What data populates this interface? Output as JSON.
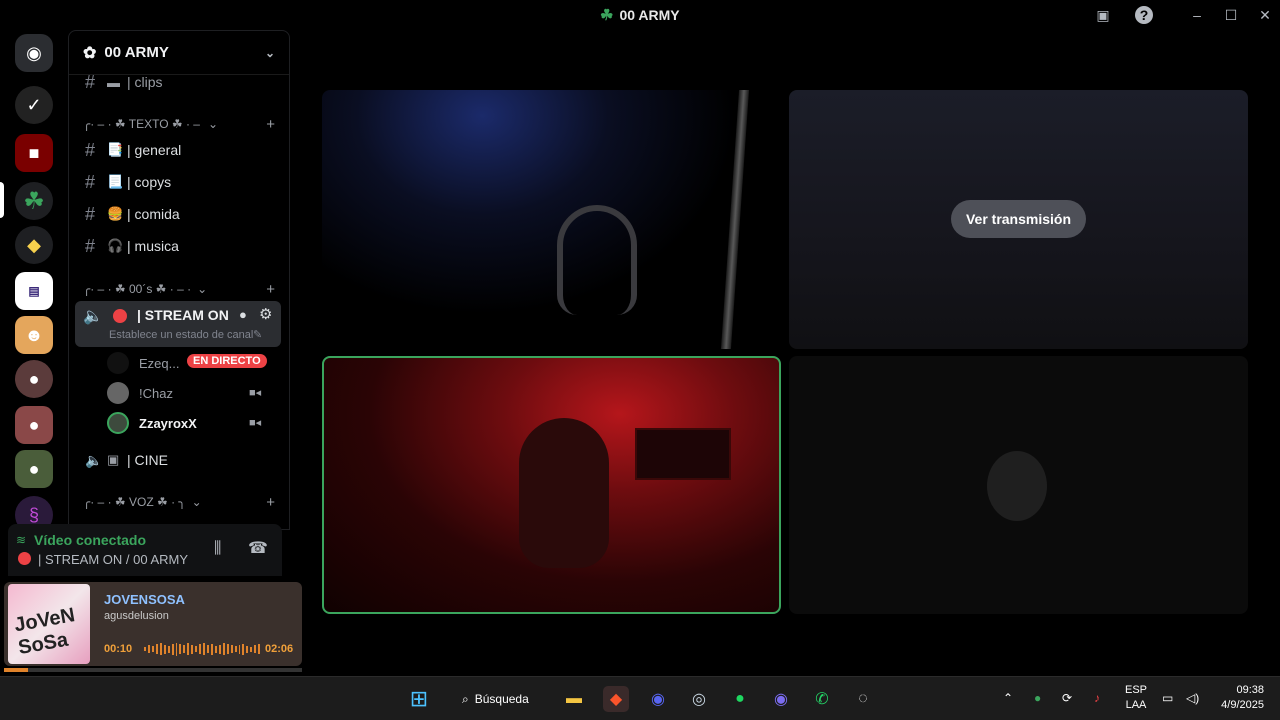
{
  "window": {
    "title": "00 ARMY"
  },
  "server": {
    "name": "00 ARMY"
  },
  "channels": {
    "top_partial": "| clips",
    "cat_texto": "╭· ‒ · ☘ TEXTO ☘ · ‒",
    "text": [
      {
        "emoji": "📑",
        "label": "| general"
      },
      {
        "emoji": "📃",
        "label": "| copys"
      },
      {
        "emoji": "🍔",
        "label": "| comida"
      },
      {
        "emoji": "🎧",
        "label": "| musica"
      }
    ],
    "cat_00s": "╭· ‒ · ☘ 00´s ☘ · ‒ ·",
    "stream_on": {
      "label": "| STREAM ON",
      "status_hint": "Establece un estado de canal"
    },
    "users": [
      {
        "name": "Ezeq...",
        "badge": "EN DIRECTO"
      },
      {
        "name": "!Chaz"
      },
      {
        "name": "ZzayroxX"
      }
    ],
    "cine": "| CINE",
    "cat_voz": "╭· ‒ · ☘ VOZ ☘ · ╮"
  },
  "voice_panel": {
    "status": "Vídeo conectado",
    "location": "| STREAM ON / 00 ARMY"
  },
  "music": {
    "cover_text": "JoVeN SoSa",
    "title": "JOVENSOSA",
    "artist": "agusdelusion",
    "elapsed": "00:10",
    "total": "02:06",
    "progress": 0.08
  },
  "stream": {
    "watch_label": "Ver transmisión"
  },
  "taskbar": {
    "search_label": "Búsqueda",
    "lang_top": "ESP",
    "lang_bottom": "LAA",
    "time": "09:38",
    "date": "4/9/2025"
  },
  "colors": {
    "accent_green": "#3ba55d",
    "live_red": "#ed4245",
    "music_orange": "#e0832b"
  }
}
